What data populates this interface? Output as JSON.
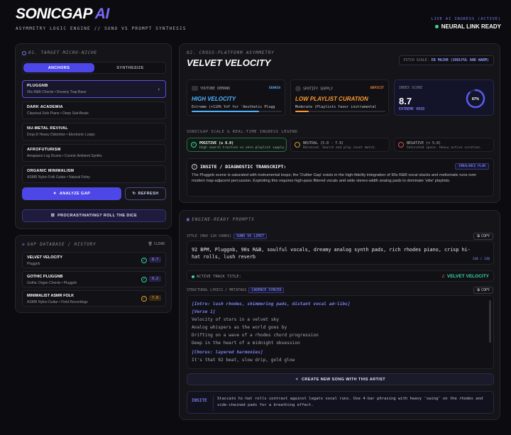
{
  "header": {
    "title_main": "SONICGAP",
    "title_accent": "AI",
    "subtitle": "ASYMMETRY LOGIC ENGINE // SUNO VS PROMPT SYNTHESIS",
    "live_label": "LIVE AI INGRESS (ACTIVE)",
    "status": "NEURAL LINK READY"
  },
  "left": {
    "section_title": "01. TARGET MICRO-NICHE",
    "tabs": {
      "anchors": "ANCHORS",
      "synthesize": "SYNTHESIZE"
    },
    "niches": [
      {
        "title": "PLUGGNB",
        "sub": "90s R&B Chords • Dreamy Trap Base"
      },
      {
        "title": "DARK ACADEMIA",
        "sub": "Classical Solo Piano • Deep Sub-Beats"
      },
      {
        "title": "NU-METAL REVIVAL",
        "sub": "Drop-D Heavy Distortion • Electronic Loops"
      },
      {
        "title": "AFROFUTURISM",
        "sub": "Amapiano Log Drums • Cosmic Ambient Synths"
      },
      {
        "title": "ORGANIC MINIMALISM",
        "sub": "ASMR Nylon Folk Guitar • Natural Foley"
      }
    ],
    "analyze": "ANALYZE GAP",
    "refresh": "REFRESH",
    "dice": "PROCRASTINATING? ROLL THE DICE"
  },
  "db": {
    "title": "GAP DATABASE / HISTORY",
    "clear": "CLEAR",
    "rows": [
      {
        "title": "VELVET VELOCITY",
        "sub": "Pluggnb",
        "score": "8.7"
      },
      {
        "title": "GOTHIC PLUGGNB",
        "sub": "Gothic Organ Chords • Pluggnb",
        "score": "9.2"
      },
      {
        "title": "MINIMALIST ASMR FOLK",
        "sub": "ASMR Nylon Guitar • Field Recordings",
        "score": "7.8"
      }
    ]
  },
  "asym": {
    "section_title": "02. CROSS-PLATFORM ASYMMETRY",
    "name": "VELVET VELOCITY",
    "pitch_label": "PITCH SCALE:",
    "pitch_value": "EB MAJOR (SOULFUL AND WARM)",
    "youtube": {
      "label": "YOUTUBE DEMAND",
      "tag": "SEARCH",
      "headline": "HIGH VELOCITY",
      "desc": "Extreme (+110% YoY for 'Aesthetic Plugg",
      "fill": 0.75
    },
    "spotify": {
      "label": "SPOTIFY SUPPLY",
      "tag": "DEFICIT",
      "headline": "LOW PLAYLIST CURATION",
      "desc": "Moderate (Playlists favor instrumental",
      "fill": 0.15
    },
    "index": {
      "label": "INDEX SCORE",
      "value": "8.7",
      "tag": "EXTREME VOID",
      "percent": "87%",
      "fraction": 0.87
    },
    "legend_title": "SONICGAP SCALE & REAL-TIME INGRESS LEGEND",
    "legend": [
      {
        "title": "POSITIVE (≥ 8.0)",
        "desc": "High search traction vs zero playlist supply."
      },
      {
        "title": "NEUTRAL (5.0 - 7.9)",
        "desc": "Balanced. Search and play count match."
      },
      {
        "title": "NEGATIVE (< 5.0)",
        "desc": "Saturated space. Heavy active curation."
      }
    ],
    "insight_title": "INSITE / DIAGNOSTIC TRANSCRIPT:",
    "insight_tag": "IMBALANCE PLAN",
    "insight_text": "The Pluggnb scene is saturated with instrumental loops; the 'Outlier Gap' exists in the high-fidelity integration of 90s R&B vocal stacks and melismatic runs over modern trap-adjacent percussion. Exploiting this requires high-pass filtered vocals and wide stereo-width analog pads to dominate 'vibe' playlists."
  },
  "prompts": {
    "section_title": "ENGINE-READY PROMPTS",
    "style_label": "STYLE (MAX 120 CHARS)",
    "style_tag": "SUNO V5 LIMIT",
    "copy": "COPY",
    "style_text": "92 BPM, Pluggnb, 90s R&B, soulful vocals, dreamy analog synth pads, rich rhodes piano, crisp hi-hat rolls, lush reverb",
    "char_count": "118 / 120",
    "track_label": "ACTIVE TRACK TITLE:",
    "track_title": "VELVET VELOCITY",
    "lyrics_label": "STRUCTURAL LYRICS / METATAGS",
    "lyrics_tag": "CADENCE SYNCED",
    "lyrics": [
      {
        "text": "[Intro: lush rhodes, shimmering pads, distant vocal ad-libs]",
        "tag": true
      },
      {
        "text": "[Verse 1]",
        "tag": true
      },
      {
        "text": "Velocity of stars in a velvet sky",
        "tag": false
      },
      {
        "text": "Analog whispers as the world goes by",
        "tag": false
      },
      {
        "text": "Drifting on a wave of a rhodes chord progression",
        "tag": false
      },
      {
        "text": "Deep in the heart of a midnight obsession",
        "tag": false
      },
      {
        "text": "[Chorus: layered harmonies]",
        "tag": true
      },
      {
        "text": "It's that 92 beat, slow drip, gold glow",
        "tag": false
      }
    ],
    "create": "CREATE NEW SONG WITH THIS ARTIST",
    "insite_label": "INSITE",
    "insite_text": "Staccato hi-hat rolls contrast against legato vocal runs. Use 4-bar phrasing with heavy 'swing' on the rhodes and side-chained pads for a breathing effect."
  }
}
